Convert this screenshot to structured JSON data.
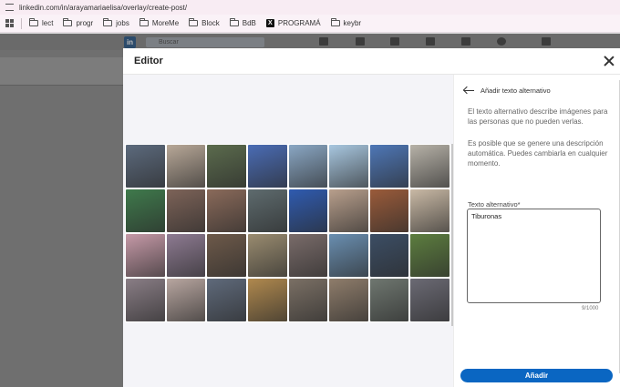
{
  "browser": {
    "url": "linkedin.com/in/arayamariaelisa/overlay/create-post/",
    "bookmarks": [
      "lect",
      "progr",
      "jobs",
      "MoreMe",
      "Block",
      "BdB",
      "PROGRAMÁ",
      "keybr"
    ]
  },
  "linkedin": {
    "search_placeholder": "Buscar"
  },
  "editor": {
    "title": "Editor",
    "photos": [
      "#5c6a7d",
      "#b8a898",
      "#5b6b4d",
      "#4a6cb5",
      "#8aa7c4",
      "#a8c7e0",
      "#4e77b7",
      "#b7b2a8",
      "#3f7a4c",
      "#7d6358",
      "#8a6a5a",
      "#5e6b6e",
      "#2f5bb0",
      "#b89f8c",
      "#9a5b3a",
      "#c9b9a5",
      "#c69aa8",
      "#8e7b92",
      "#6e5a4a",
      "#9a8c70",
      "#7a6c6a",
      "#6a8fb1",
      "#3c4e65",
      "#5d7e3f",
      "#8a7e86",
      "#b8a6a0",
      "#5f6a7b",
      "#b0894e",
      "#7b7065",
      "#8f7d6b",
      "#6f7770",
      "#6b6a74"
    ],
    "alt_panel": {
      "title": "Añadir texto alternativo",
      "description": "El texto alternativo describe imágenes para las personas que no pueden verlas.",
      "description2": "Es posible que se genere una descripción automática. Puedes cambiarla en cualquier momento.",
      "field_label": "Texto alternativo*",
      "value": "Tiburonas",
      "counter": "9/1000"
    },
    "add_label": "Añadir"
  }
}
